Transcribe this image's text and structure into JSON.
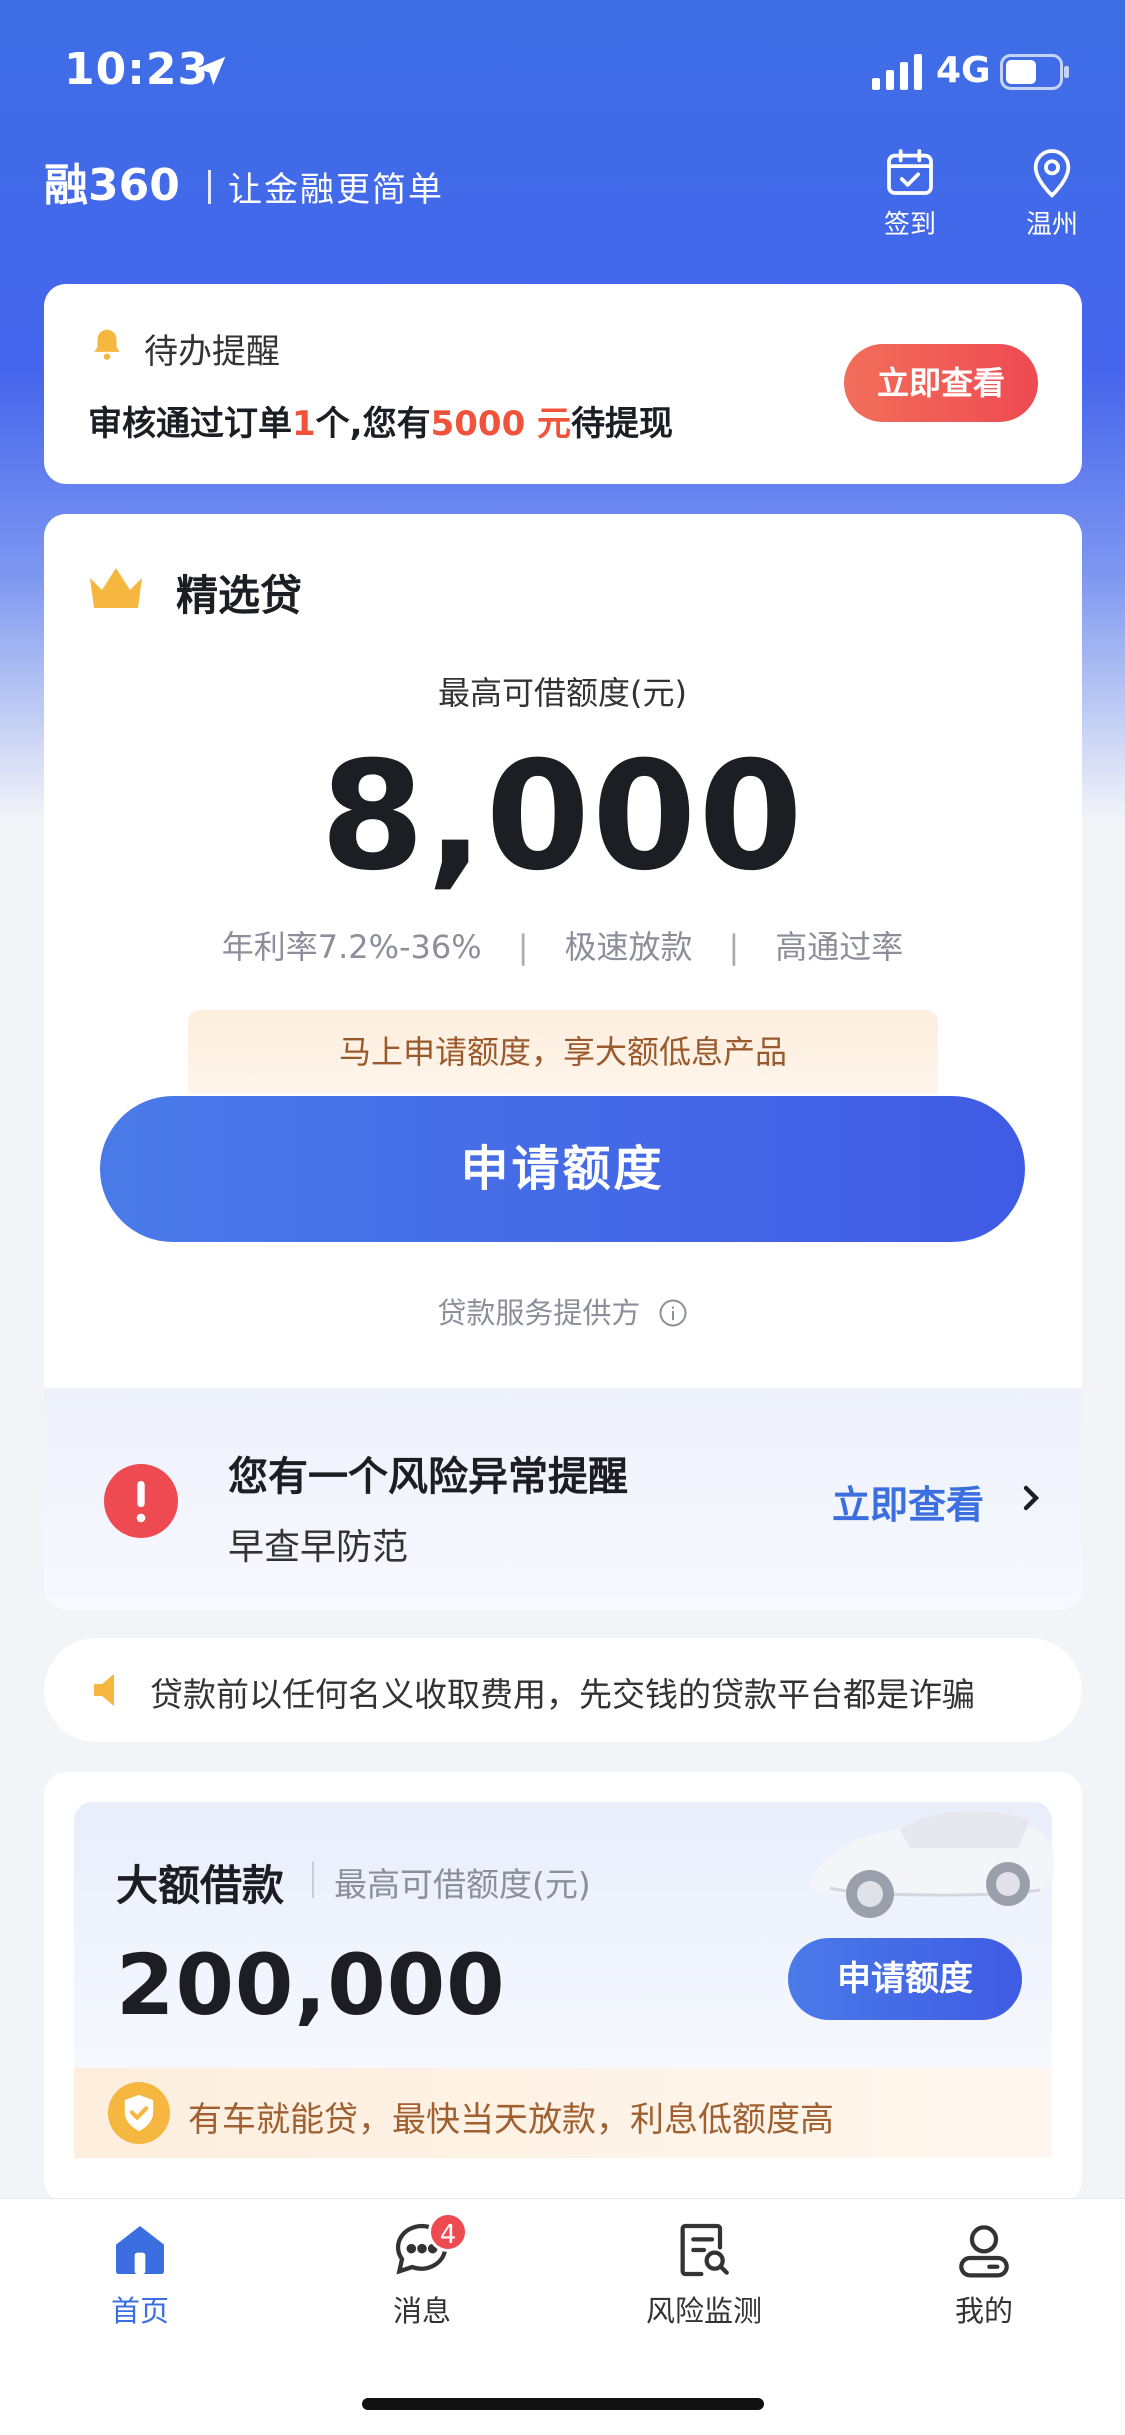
{
  "status_bar": {
    "time": "10:23",
    "network": "4G"
  },
  "header": {
    "logo": "融360",
    "slogan": "让金融更简单",
    "checkin_label": "签到",
    "city_label": "温州"
  },
  "todo": {
    "title": "待办提醒",
    "text_1": "审核通过订单",
    "order_count": "1",
    "text_2": "个,您有",
    "amount": "5000 元",
    "text_3": "待提现",
    "button": "立即查看"
  },
  "featured": {
    "title": "精选贷",
    "limit_label": "最高可借额度(元)",
    "amount": "8,000",
    "features": [
      "年利率7.2%-36%",
      "极速放款",
      "高通过率"
    ],
    "feature_sep": "|",
    "promo": "马上申请额度，享大额低息产品",
    "apply_button": "申请额度",
    "provider": "贷款服务提供方"
  },
  "risk": {
    "title": "您有一个风险异常提醒",
    "subtitle": "早查早防范",
    "link": "立即查看"
  },
  "warning": {
    "text": "贷款前以任何名义收取费用，先交钱的贷款平台都是诈骗"
  },
  "large_loan": {
    "title": "大额借款",
    "limit_label": "最高可借额度(元)",
    "amount": "200,000",
    "button": "申请额度",
    "strip": "有车就能贷，最快当天放款，利息低额度高"
  },
  "tabs": [
    {
      "label": "首页",
      "icon": "home-icon",
      "active": true
    },
    {
      "label": "消息",
      "icon": "message-icon",
      "badge": "4"
    },
    {
      "label": "风险监测",
      "icon": "report-search-icon"
    },
    {
      "label": "我的",
      "icon": "profile-icon"
    }
  ],
  "colors": {
    "accent": "#3f5be4",
    "alert": "#ee4a52",
    "highlight": "#f0533a"
  }
}
